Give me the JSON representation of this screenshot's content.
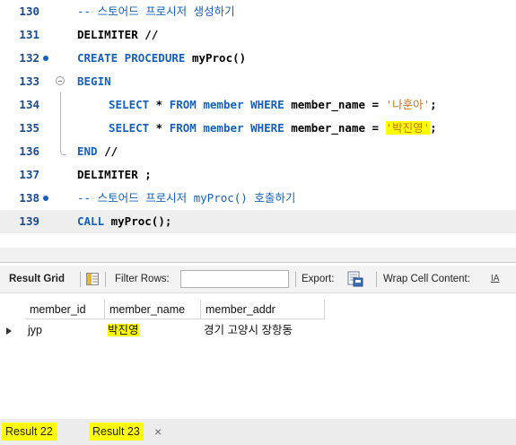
{
  "editor": {
    "lines": [
      {
        "num": "130",
        "tokens": [
          {
            "t": "-- 스토어드 프로시저 생성하기",
            "c": "cm"
          }
        ]
      },
      {
        "num": "131",
        "tokens": [
          {
            "t": "DELIMITER //",
            "c": "pl"
          }
        ]
      },
      {
        "num": "132",
        "tokens": [
          {
            "t": "CREATE PROCEDURE ",
            "c": "kw"
          },
          {
            "t": "myProc()",
            "c": "pl"
          }
        ]
      },
      {
        "num": "133",
        "tokens": [
          {
            "t": "BEGIN",
            "c": "kw"
          }
        ]
      },
      {
        "num": "134",
        "tokens": [
          {
            "t": "SELECT",
            "c": "kw"
          },
          {
            "t": " * ",
            "c": "pl"
          },
          {
            "t": "FROM",
            "c": "kw"
          },
          {
            "t": " member ",
            "c": "kw"
          },
          {
            "t": "WHERE",
            "c": "kw"
          },
          {
            "t": " member_name = ",
            "c": "pl"
          },
          {
            "t": "'나훈아'",
            "c": "str"
          },
          {
            "t": ";",
            "c": "pl"
          }
        ]
      },
      {
        "num": "135",
        "tokens": [
          {
            "t": "SELECT",
            "c": "kw"
          },
          {
            "t": " * ",
            "c": "pl"
          },
          {
            "t": "FROM",
            "c": "kw"
          },
          {
            "t": " member ",
            "c": "kw"
          },
          {
            "t": "WHERE",
            "c": "kw"
          },
          {
            "t": " member_name = ",
            "c": "pl"
          },
          {
            "t": "'박진영'",
            "c": "str hl"
          },
          {
            "t": ";",
            "c": "pl"
          }
        ]
      },
      {
        "num": "136",
        "tokens": [
          {
            "t": "END",
            "c": "kw"
          },
          {
            "t": " //",
            "c": "pl"
          }
        ]
      },
      {
        "num": "137",
        "tokens": [
          {
            "t": "DELIMITER ;",
            "c": "pl"
          }
        ]
      },
      {
        "num": "138",
        "tokens": [
          {
            "t": "-- 스토어드 프로시저 myProc() 호출하기",
            "c": "cm"
          }
        ]
      },
      {
        "num": "139",
        "tokens": [
          {
            "t": "CALL",
            "c": "kw"
          },
          {
            "t": " myProc();",
            "c": "pl"
          }
        ]
      }
    ]
  },
  "toolbar": {
    "result_grid_label": "Result Grid",
    "filter_rows_label": "Filter Rows:",
    "filter_value": "",
    "export_label": "Export:",
    "wrap_label": "Wrap Cell Content:",
    "wrap_icon_text": "IA"
  },
  "grid": {
    "columns": [
      "member_id",
      "member_name",
      "member_addr"
    ],
    "rows": [
      [
        "jyp",
        "박진영",
        "경기 고양시 장항동"
      ]
    ]
  },
  "tabs": {
    "items": [
      "Result 22",
      "Result 23"
    ],
    "close_glyph": "×"
  },
  "colors": {
    "keyword": "#1560bd",
    "string": "#c8731e",
    "highlight": "#ffff00",
    "line_number": "#1a4a8a"
  }
}
